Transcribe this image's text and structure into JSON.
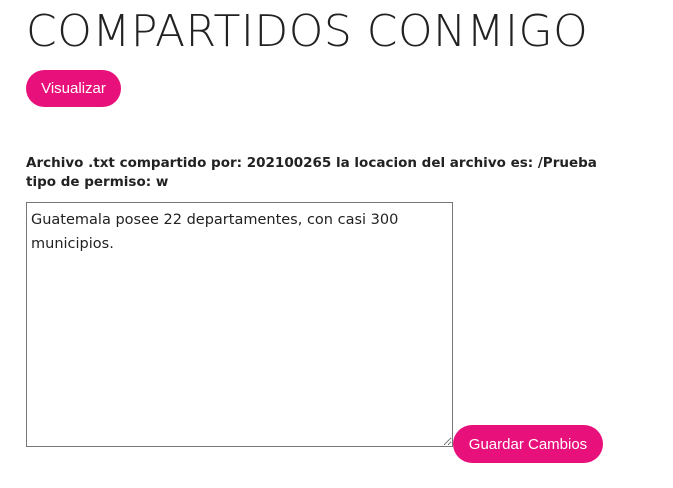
{
  "header": {
    "title": "COMPARTIDOS CONMIGO"
  },
  "actions": {
    "visualizar_label": "Visualizar",
    "guardar_label": "Guardar Cambios"
  },
  "shared_file": {
    "info_text": "Archivo .txt compartido por: 202100265 la locacion del archivo es: /Prueba tipo de permiso: w",
    "content": "Guatemala posee 22 departamentes, con casi 300 municipios."
  },
  "colors": {
    "accent": "#e8107a",
    "text": "#222222"
  }
}
